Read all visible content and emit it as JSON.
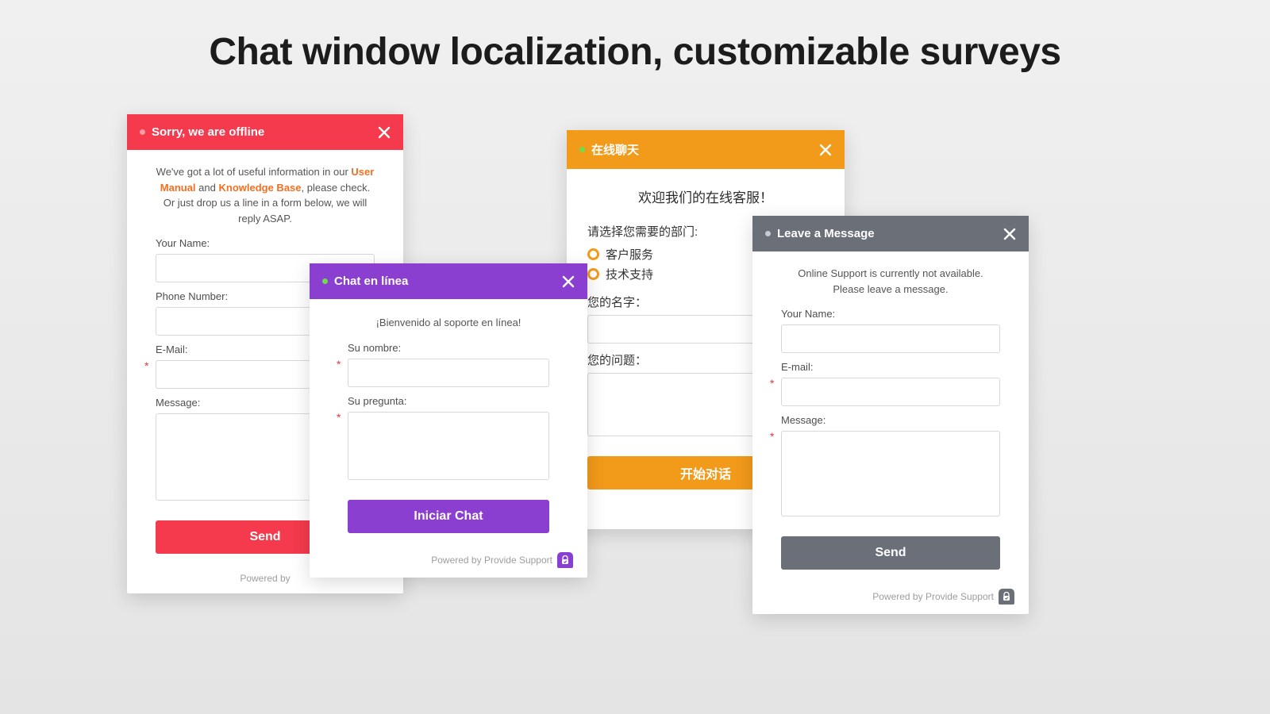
{
  "page_title": "Chat window localization, customizable surveys",
  "powered_by": "Powered by Provide Support",
  "powered_by_short": "Powered by",
  "windows": {
    "red": {
      "title": "Sorry, we are offline",
      "intro_1": "We've got a lot of useful information in our ",
      "link_manual": "User Manual",
      "intro_2": " and ",
      "link_kb": "Knowledge Base",
      "intro_3": ", please check. Or just drop us a line in a form below, we will reply ASAP.",
      "label_name": "Your Name:",
      "label_phone": "Phone Number:",
      "label_email": "E-Mail:",
      "label_message": "Message:",
      "button": "Send"
    },
    "purple": {
      "title": "Chat en línea",
      "intro": "¡Bienvenido al soporte en línea!",
      "label_name": "Su nombre:",
      "label_question": "Su pregunta:",
      "button": "Iniciar Chat"
    },
    "orange": {
      "title": "在线聊天",
      "intro": "欢迎我们的在线客服！",
      "dept_label": "请选择您需要的部门:",
      "dept_1": "客户服务",
      "dept_2": "技术支持",
      "label_name": "您的名字：",
      "label_question": "您的问题：",
      "button": "开始对话"
    },
    "gray": {
      "title": "Leave a Message",
      "intro": "Online Support is currently not available. Please leave a message.",
      "label_name": "Your Name:",
      "label_email": "E-mail:",
      "label_message": "Message:",
      "button": "Send"
    }
  }
}
